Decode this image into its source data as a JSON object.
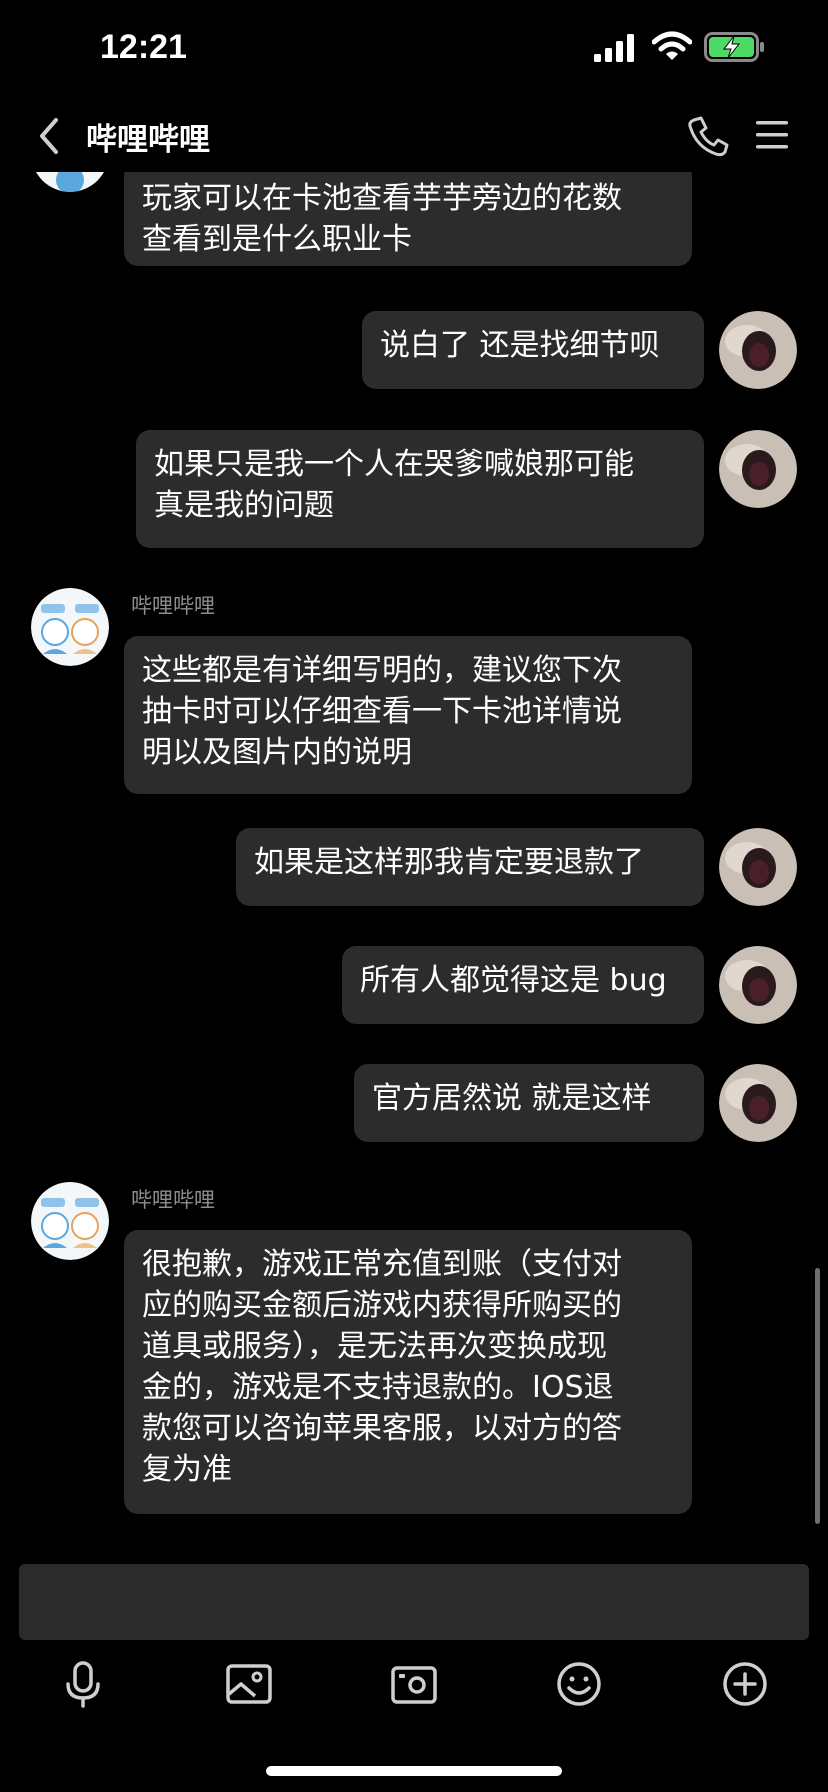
{
  "status_bar": {
    "time": "12:21",
    "icons": [
      "signal-icon",
      "wifi-icon",
      "battery-charging-icon"
    ],
    "battery_color": "#4cd964"
  },
  "nav": {
    "title": "哔哩哔哩",
    "back_icon": "chevron-left-icon",
    "call_icon": "phone-icon",
    "menu_icon": "menu-icon"
  },
  "messages": [
    {
      "side": "left",
      "text": "玩家可以在卡池查看芋芋旁边的花数\n查看到是什么职业卡"
    },
    {
      "side": "right",
      "text": "说白了 还是找细节呗"
    },
    {
      "side": "right",
      "text": "如果只是我一个人在哭爹喊娘那可能\n真是我的问题"
    },
    {
      "side": "left",
      "sender": "哔哩哔哩",
      "text": "这些都是有详细写明的，建议您下次\n抽卡时可以仔细查看一下卡池详情说\n明以及图片内的说明"
    },
    {
      "side": "right",
      "text": "如果是这样那我肯定要退款了"
    },
    {
      "side": "right",
      "text": "所有人都觉得这是 bug"
    },
    {
      "side": "right",
      "text": "官方居然说 就是这样"
    },
    {
      "side": "left",
      "sender": "哔哩哔哩",
      "text": "很抱歉，游戏正常充值到账（支付对\n应的购买金额后游戏内获得所购买的\n道具或服务），是无法再次变换成现\n金的，游戏是不支持退款的。IOS退\n款您可以咨询苹果客服，以对方的答\n复为准"
    }
  ],
  "toolbar": {
    "icons": [
      "microphone-icon",
      "image-icon",
      "camera-icon",
      "emoji-icon",
      "plus-icon"
    ]
  },
  "colors": {
    "background": "#000000",
    "bubble": "#2c2c2c",
    "sender_name": "#8d8d8d",
    "input_box": "#2b2b2b"
  }
}
